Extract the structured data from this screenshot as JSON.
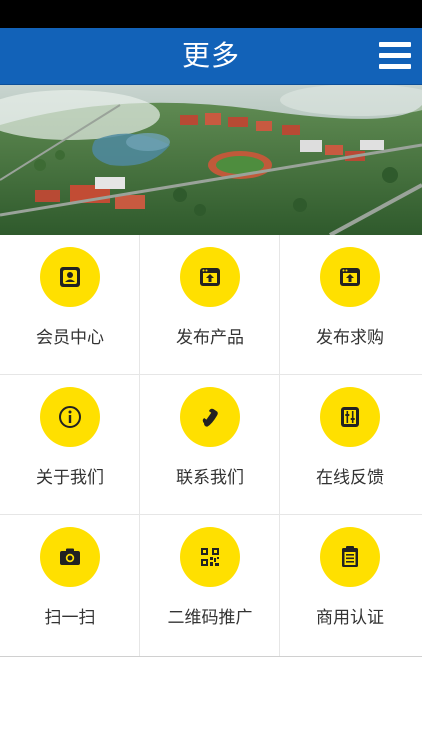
{
  "header": {
    "title": "更多",
    "menu_icon": "hamburger-menu-icon",
    "background_color": "#1262b8"
  },
  "banner": {
    "alt": "campus aerial view"
  },
  "grid": {
    "accent_color": "#ffe000",
    "items": [
      {
        "label": "会员中心",
        "icon": "member-card-icon"
      },
      {
        "label": "发布产品",
        "icon": "upload-window-icon"
      },
      {
        "label": "发布求购",
        "icon": "upload-window-icon"
      },
      {
        "label": "关于我们",
        "icon": "info-icon"
      },
      {
        "label": "联系我们",
        "icon": "phone-icon"
      },
      {
        "label": "在线反馈",
        "icon": "feedback-icon"
      },
      {
        "label": "扫一扫",
        "icon": "camera-icon"
      },
      {
        "label": "二维码推广",
        "icon": "qr-code-icon"
      },
      {
        "label": "商用认证",
        "icon": "clipboard-icon"
      }
    ]
  }
}
